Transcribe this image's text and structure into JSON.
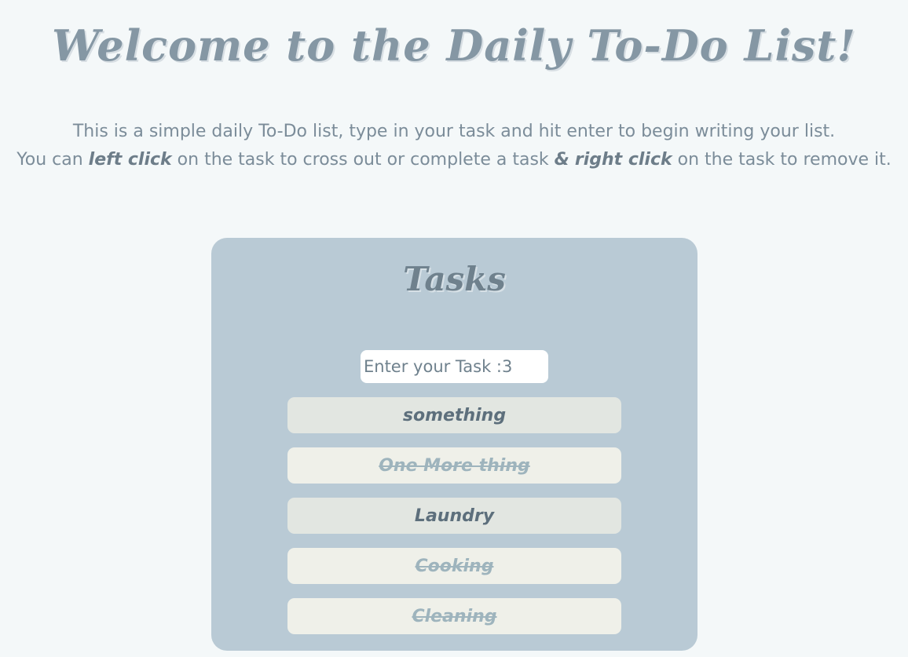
{
  "header": {
    "title": "Welcome to the Daily To-Do List!"
  },
  "intro": {
    "line1": "This is a simple daily To-Do list, type in your task and hit enter to begin writing your list.",
    "line2_prefix": "You can ",
    "left_click": "left click",
    "line2_middle": " on the task to cross out or complete a task ",
    "ampersand": "&",
    "right_click": "right click",
    "line2_suffix": " on the task to remove it."
  },
  "panel": {
    "title": "Tasks",
    "input_placeholder": "Enter your Task :3",
    "input_value": "",
    "tasks": [
      {
        "label": "something",
        "completed": false
      },
      {
        "label": "One More thing",
        "completed": true
      },
      {
        "label": "Laundry",
        "completed": false
      },
      {
        "label": "Cooking",
        "completed": true
      },
      {
        "label": "Cleaning",
        "completed": true
      }
    ]
  },
  "colors": {
    "page_background": "#f4f8f9",
    "panel_background": "#b9cad5",
    "task_active_background": "#e2e6e1",
    "task_done_background": "#eff0e9",
    "title_color": "#8597a4"
  }
}
